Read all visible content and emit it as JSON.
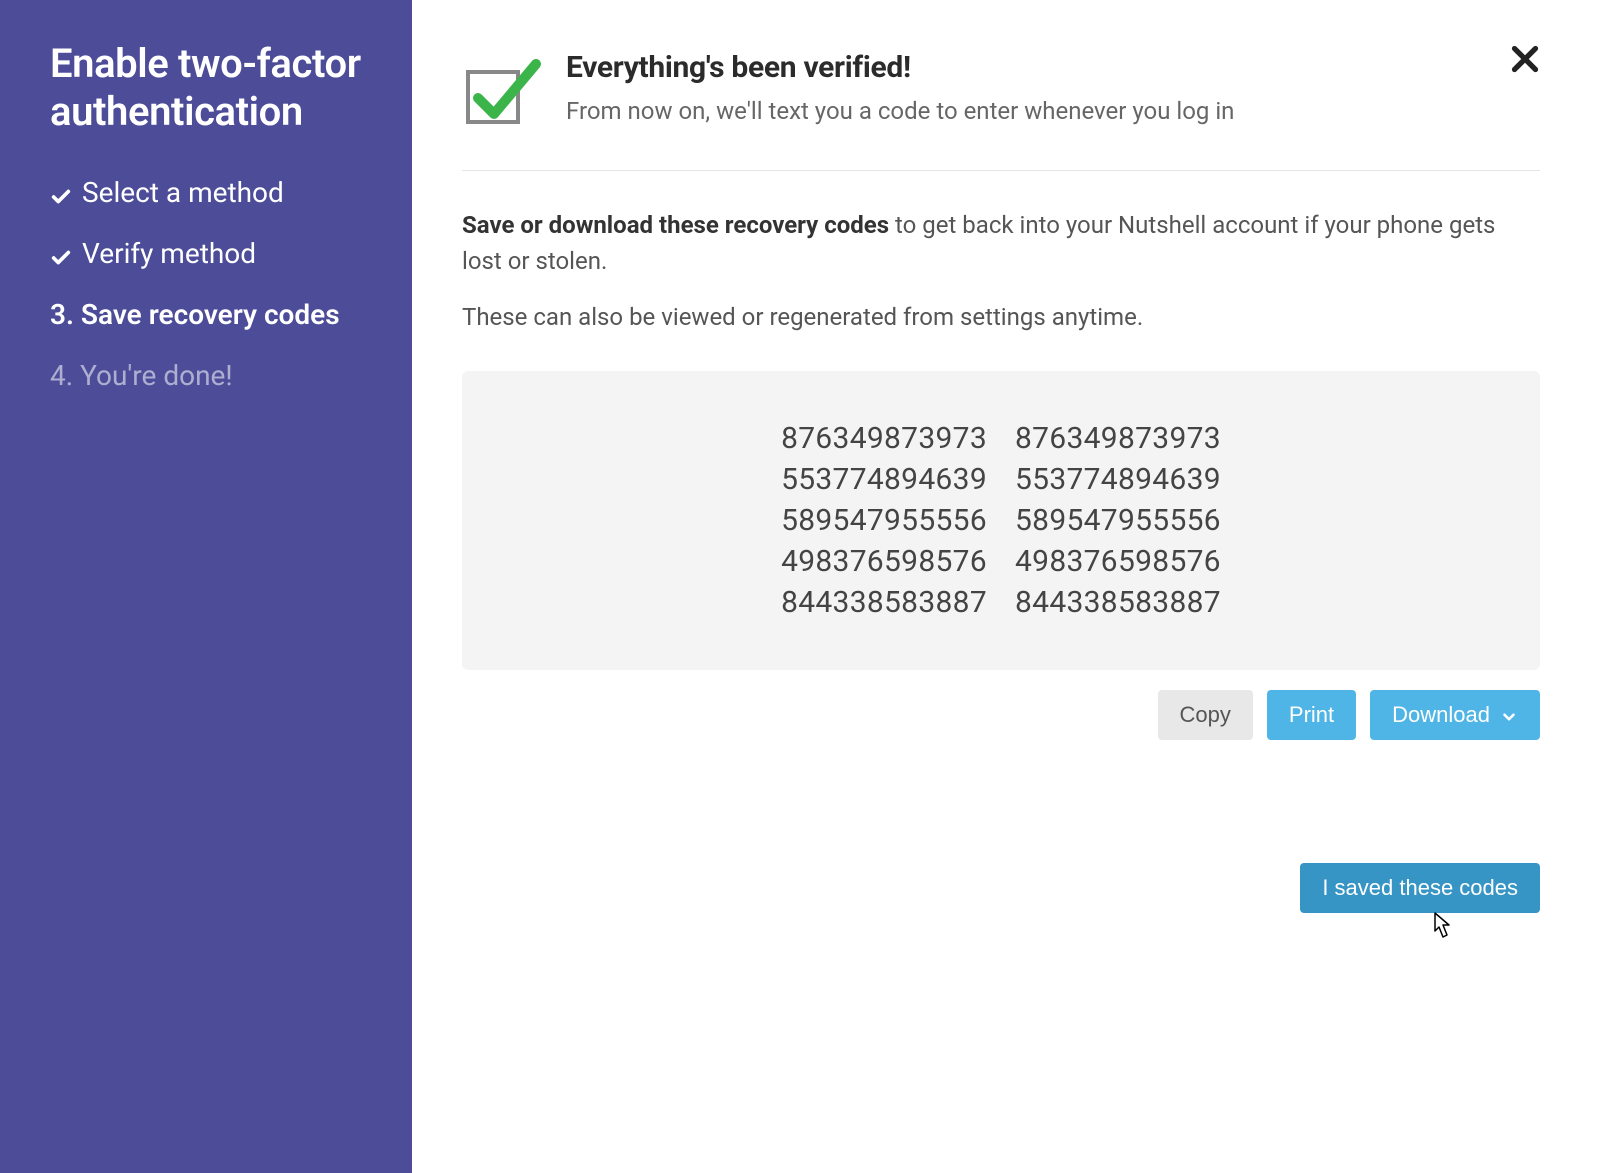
{
  "sidebar": {
    "title": "Enable two-factor authentication",
    "steps": [
      {
        "label": "Select a method",
        "status": "done"
      },
      {
        "label": "Verify method",
        "status": "done"
      },
      {
        "label": "3. Save recovery codes",
        "status": "current"
      },
      {
        "label": "4. You're done!",
        "status": "future"
      }
    ]
  },
  "header": {
    "title": "Everything's been verified!",
    "subtitle": "From now on, we'll text you a code to enter whenever you log in"
  },
  "instructions": {
    "bold": "Save or download these recovery codes",
    "rest": " to get back into your Nutshell account if your phone gets lost or stolen.",
    "sub": "These can also be viewed or regenerated from settings anytime."
  },
  "recovery_codes": {
    "left": [
      "876349873973",
      "553774894639",
      "589547955556",
      "498376598576",
      "844338583887"
    ],
    "right": [
      "876349873973",
      "553774894639",
      "589547955556",
      "498376598576",
      "844338583887"
    ]
  },
  "actions": {
    "copy": "Copy",
    "print": "Print",
    "download": "Download",
    "save": "I saved these codes"
  }
}
